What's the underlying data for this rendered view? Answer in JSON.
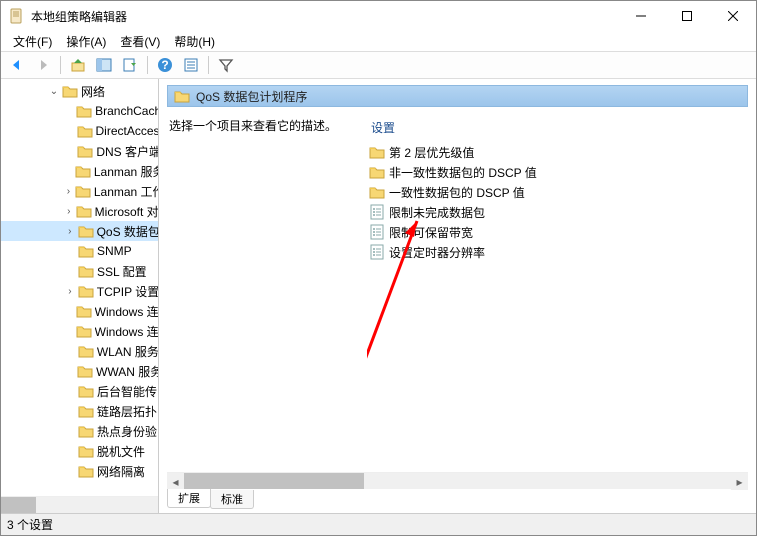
{
  "window": {
    "title": "本地组策略编辑器"
  },
  "menu": {
    "file": "文件(F)",
    "action": "操作(A)",
    "view": "查看(V)",
    "help": "帮助(H)"
  },
  "tree": {
    "root": "网络",
    "items": [
      "BranchCache",
      "DirectAccess",
      "DNS 客户端",
      "Lanman 服务器",
      "Lanman 工作站",
      "Microsoft 对等",
      "QoS 数据包",
      "SNMP",
      "SSL 配置",
      "TCPIP 设置",
      "Windows 连接",
      "Windows 连接",
      "WLAN 服务",
      "WWAN 服务",
      "后台智能传",
      "链路层拓扑",
      "热点身份验",
      "脱机文件",
      "网络隔离"
    ],
    "expandable_idx": [
      4,
      5,
      6,
      9
    ],
    "selected_idx": 6
  },
  "content": {
    "header": "QoS 数据包计划程序",
    "description": "选择一个项目来查看它的描述。",
    "column_header": "设置",
    "items": [
      {
        "type": "folder",
        "label": "第 2 层优先级值"
      },
      {
        "type": "folder",
        "label": "非一致性数据包的 DSCP 值"
      },
      {
        "type": "folder",
        "label": "一致性数据包的 DSCP 值"
      },
      {
        "type": "setting",
        "label": "限制未完成数据包"
      },
      {
        "type": "setting",
        "label": "限制可保留带宽"
      },
      {
        "type": "setting",
        "label": "设置定时器分辨率"
      }
    ]
  },
  "tabs": {
    "extended": "扩展",
    "standard": "标准"
  },
  "status": "3 个设置"
}
